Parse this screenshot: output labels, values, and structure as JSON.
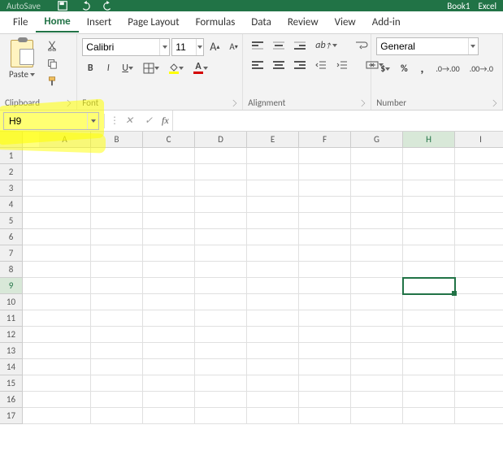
{
  "titlebar": {
    "autosave": "AutoSave",
    "docname": "Book1",
    "appname": "Excel"
  },
  "tabs": [
    "File",
    "Home",
    "Insert",
    "Page Layout",
    "Formulas",
    "Data",
    "Review",
    "View",
    "Add-in"
  ],
  "active_tab": "Home",
  "clipboard": {
    "label": "Clipboard",
    "paste": "Paste"
  },
  "font": {
    "label": "Font",
    "name": "Calibri",
    "size": "11",
    "bold": "B",
    "italic": "I",
    "underline": "U",
    "grow": "A",
    "shrink": "A",
    "font_A": "A"
  },
  "alignment": {
    "label": "Alignment"
  },
  "number": {
    "label": "Number",
    "format": "General",
    "pct": "%",
    "comma": ",",
    "currency": "$"
  },
  "namebox": "H9",
  "fx": "fx",
  "formula": "",
  "columns": [
    "A",
    "B",
    "C",
    "D",
    "E",
    "F",
    "G",
    "H",
    "I"
  ],
  "rows": [
    "1",
    "2",
    "3",
    "4",
    "5",
    "6",
    "7",
    "8",
    "9",
    "10",
    "11",
    "12",
    "13",
    "14",
    "15",
    "16",
    "17"
  ],
  "selected_col": "H",
  "selected_row": "9"
}
